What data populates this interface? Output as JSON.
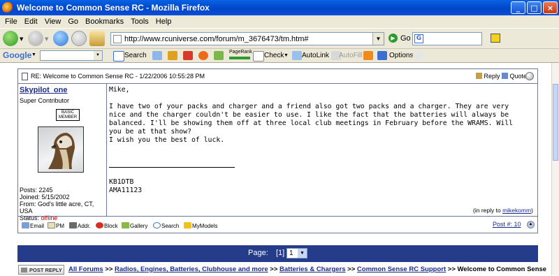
{
  "window": {
    "title": "Welcome to Common Sense RC - Mozilla Firefox",
    "minimize_glyph": "_",
    "maximize_glyph": "□",
    "close_glyph": "×"
  },
  "menu": [
    "File",
    "Edit",
    "View",
    "Go",
    "Bookmarks",
    "Tools",
    "Help"
  ],
  "nav": {
    "url": "http://www.rcuniverse.com/forum/m_3676473/tm.htm#",
    "go_label": "Go",
    "search_engine_icon": "google-g-icon"
  },
  "google_toolbar": {
    "logo": "Google",
    "search_label": "Search",
    "pagerank_label": "PageRank",
    "check_label": "Check",
    "autolink_label": "AutoLink",
    "autofill_label": "AutoFill",
    "options_label": "Options"
  },
  "post": {
    "subject": "RE: Welcome to Common Sense RC - 1/22/2006 10:55:28 PM",
    "reply_label": "Reply",
    "quote_label": "Quote",
    "author": {
      "username": "Skypilot_one",
      "rank": "Super Contributor",
      "badge_line1": "BASIC",
      "badge_line2": "MEMBER",
      "posts": "Posts: 2245",
      "joined": "Joined: 5/15/2002",
      "from": "From: God's little acre, CT, USA",
      "status_label": "Status:",
      "status_value": "offline"
    },
    "body": {
      "greeting": "Mike,",
      "paragraph1": "I have two of your packs and charger and a friend also got two packs and a charger. They are very nice and the charger couldn't be easier to use. I like the fact that the batteries will always be balanced. I'll be showing them off at three local club meetings in February before the WRAMS. Will you be at that show?",
      "paragraph2": "I wish you the best of luck.",
      "signature_line1": "KB1DTB",
      "signature_line2": "AMA11123"
    },
    "in_reply_prefix": "(in reply to ",
    "in_reply_user": "mikekomm",
    "in_reply_suffix": ")",
    "footer": {
      "email": "Email",
      "pm": "PM",
      "addr": "Addr.",
      "block": "Block",
      "gallery": "Gallery",
      "search": "Search",
      "mymodels": "MyModels",
      "post_number": "Post #: 10"
    }
  },
  "pager": {
    "label": "Page:",
    "current": "[1]",
    "selected": "1"
  },
  "breadcrumbs": {
    "post_reply": "POST REPLY",
    "items": [
      "All Forums",
      "Radios, Engines, Batteries, Clubhouse and more",
      "Batteries & Chargers",
      "Common Sense RC Support"
    ],
    "separator": ">>",
    "current": "Welcome to Common Sense"
  },
  "colors": {
    "titlebar": "#0a4fd8",
    "pager_bg": "#253c8a",
    "link": "#1a2a8f",
    "offline": "#e00000"
  }
}
